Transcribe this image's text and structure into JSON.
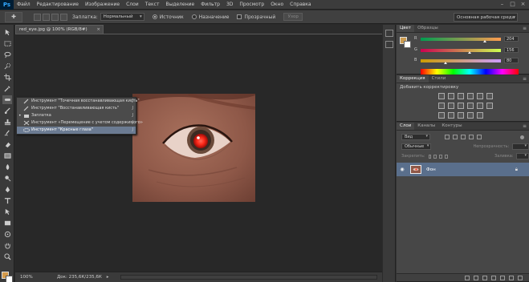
{
  "app": {
    "logo": "Ps"
  },
  "menu": [
    "Файл",
    "Редактирование",
    "Изображение",
    "Слои",
    "Текст",
    "Выделение",
    "Фильтр",
    "3D",
    "Просмотр",
    "Окно",
    "Справка"
  ],
  "options": {
    "patch_label": "Заплатка:",
    "patch_mode": "Нормальный",
    "source_label": "Источник",
    "destination_label": "Назначение",
    "transparent_label": "Прозрачный",
    "pattern_button": "Узор"
  },
  "workspace": "Основная рабочая среда",
  "document": {
    "tab_title": "red_eye.jpg @ 100% (RGB/8#)",
    "close": "×"
  },
  "flyout": [
    {
      "label": "Инструмент \"Точечная восстанавливающая кисть\"",
      "key": "J",
      "icon": "spot-healing-brush-icon"
    },
    {
      "label": "Инструмент \"Восстанавливающая кисть\"",
      "key": "J",
      "icon": "healing-brush-icon"
    },
    {
      "label": "Заплатка",
      "key": "J",
      "icon": "patch-icon",
      "current": true
    },
    {
      "label": "Инструмент «Перемещение с учетом содержимого»",
      "key": "J",
      "icon": "content-aware-move-icon"
    },
    {
      "label": "Инструмент \"Красные глаза\"",
      "key": "J",
      "icon": "red-eye-icon",
      "selected": true
    }
  ],
  "status": {
    "zoom": "100%",
    "doc": "Док: 235,6К/235,6К"
  },
  "color_panel": {
    "tabs": [
      "Цвет",
      "Образцы"
    ],
    "channels": [
      {
        "letter": "R",
        "value": "204"
      },
      {
        "letter": "G",
        "value": "156"
      },
      {
        "letter": "B",
        "value": "80"
      }
    ],
    "levels": {
      "R": 0.8,
      "G": 0.61,
      "B": 0.31
    },
    "foreground": "#cc9c50",
    "background": "#ffffff"
  },
  "correction_panel": {
    "tabs": [
      "Коррекция",
      "Стили"
    ],
    "subtitle": "Добавить корректировку"
  },
  "layers_panel": {
    "tabs": [
      "Слои",
      "Каналы",
      "Контуры"
    ],
    "kind": "Вид",
    "blend": "Обычные",
    "opacity_label": "Непрозрачность:",
    "lock_label": "Закрепить:",
    "fill_label": "Заливка:",
    "layer_name": "Фон"
  }
}
